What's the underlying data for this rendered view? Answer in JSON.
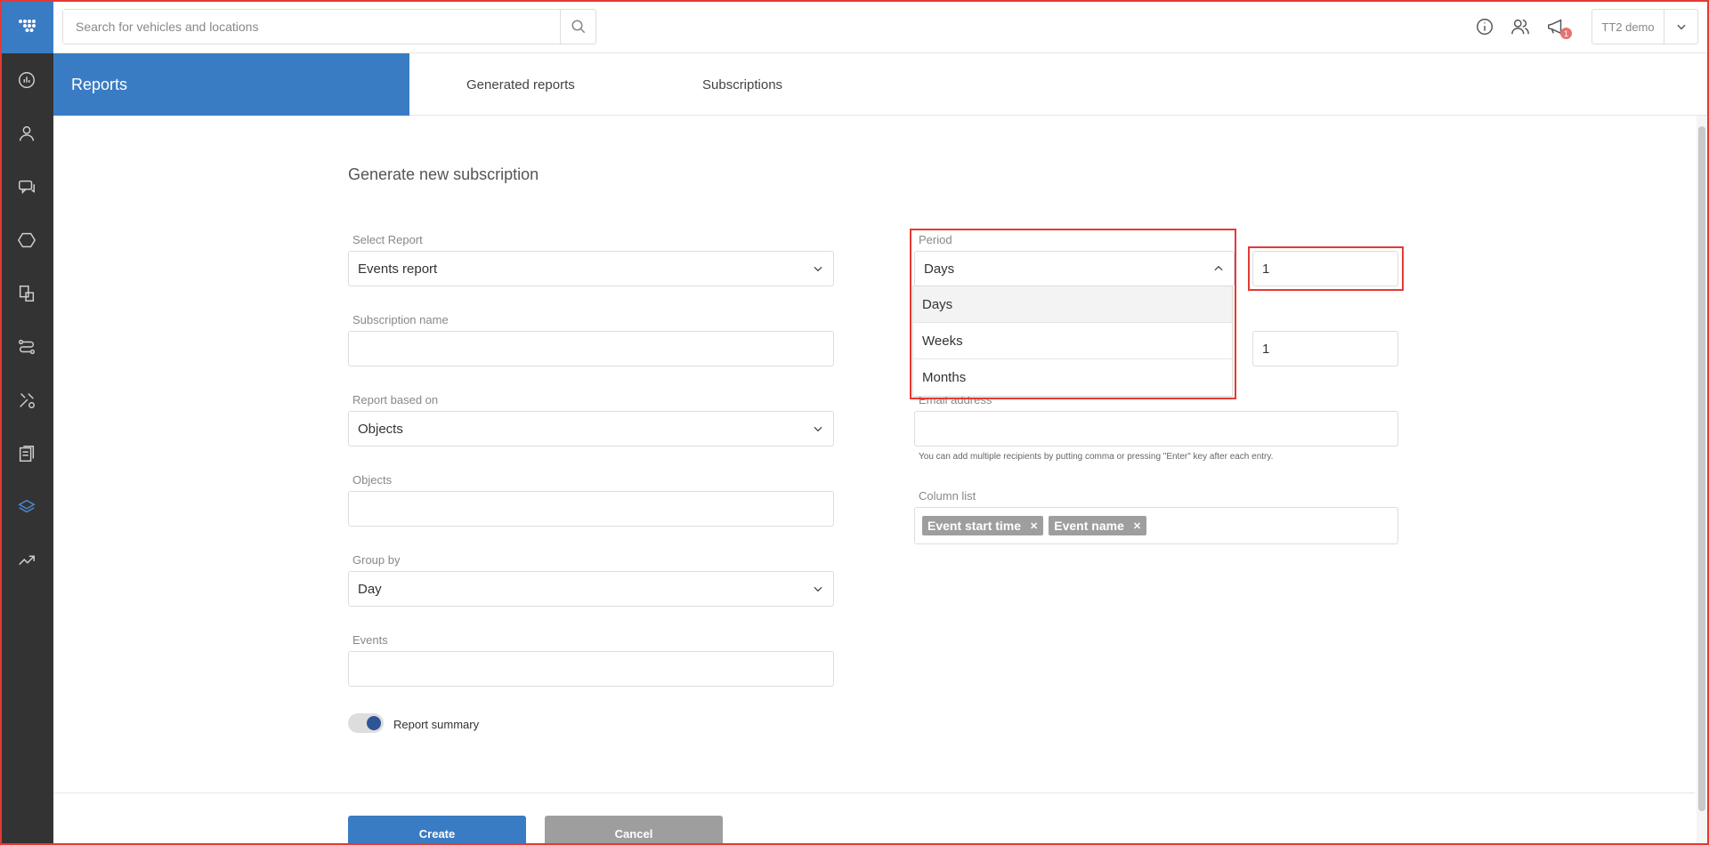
{
  "search": {
    "placeholder": "Search for vehicles and locations"
  },
  "topbar": {
    "notification_count": "1",
    "user_name": "TT2 demo"
  },
  "tabs": {
    "section_title": "Reports",
    "items": [
      "Generated reports",
      "Subscriptions"
    ]
  },
  "form": {
    "title": "Generate new subscription",
    "select_report": {
      "label": "Select Report",
      "value": "Events report"
    },
    "subscription_name": {
      "label": "Subscription name",
      "value": ""
    },
    "report_based_on": {
      "label": "Report based on",
      "value": "Objects"
    },
    "objects": {
      "label": "Objects",
      "value": ""
    },
    "group_by": {
      "label": "Group by",
      "value": "Day"
    },
    "events": {
      "label": "Events",
      "value": ""
    },
    "report_summary": {
      "label": "Report summary",
      "enabled": true
    },
    "period": {
      "label": "Period",
      "value": "Days",
      "options": [
        "Days",
        "Weeks",
        "Months"
      ],
      "count": "1"
    },
    "second_count": "1",
    "email": {
      "label": "Email address",
      "hint": "You can add multiple recipients by putting comma or pressing \"Enter\" key after each entry."
    },
    "column_list": {
      "label": "Column list",
      "chips": [
        "Event start time",
        "Event name"
      ]
    }
  },
  "buttons": {
    "create": "Create",
    "cancel": "Cancel"
  },
  "colors": {
    "primary": "#3a7cc4",
    "sidebar": "#333333",
    "highlight": "#e53935",
    "chip": "#9e9e9e",
    "cancel": "#9e9e9e"
  }
}
